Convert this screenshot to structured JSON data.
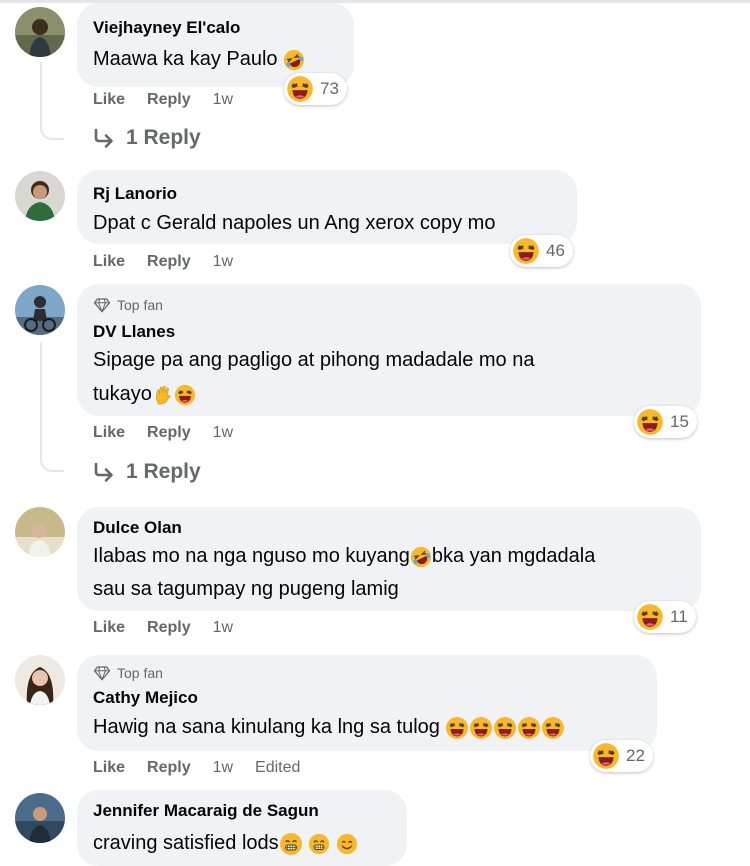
{
  "ui": {
    "like": "Like",
    "reply": "Reply",
    "top_fan": "Top fan",
    "edited": "Edited"
  },
  "comments": [
    {
      "author": "Viejhayney El'calo",
      "text": "Maawa ka kay Paulo",
      "reactions": "73",
      "time": "1w",
      "replies": "1 Reply"
    },
    {
      "author": "Rj Lanorio",
      "text": "Dpat c Gerald napoles un Ang xerox copy mo",
      "reactions": "46",
      "time": "1w"
    },
    {
      "author": "DV Llanes",
      "badge": "Top fan",
      "text_line1": "Sipage pa ang pagligo at pihong madadale mo na",
      "text_line2": "tukayo",
      "reactions": "15",
      "time": "1w",
      "replies": "1 Reply"
    },
    {
      "author": "Dulce Olan",
      "text_line1": "Ilabas mo na nga nguso mo kuyang",
      "text_line1b": "bka yan mgdadala",
      "text_line2": "sau sa tagumpay ng pugeng lamig",
      "reactions": "11",
      "time": "1w"
    },
    {
      "author": "Cathy Mejico",
      "badge": "Top fan",
      "text": "Hawig na sana kinulang ka lng sa tulog",
      "reactions": "22",
      "time": "1w"
    },
    {
      "author": "Jennifer Macaraig de Sagun",
      "text": "craving satisfied lods"
    }
  ],
  "colors": {
    "bubble": "#f0f2f5",
    "muted": "#65676b",
    "emoji": "#f7b928",
    "mouth": "#8a1c1c"
  },
  "icons": [
    "laughing-emoji-icon",
    "rofl-emoji-icon",
    "hand-emoji-icon",
    "diamond-icon",
    "reply-arrow-icon",
    "smiling-emoji-icon"
  ]
}
